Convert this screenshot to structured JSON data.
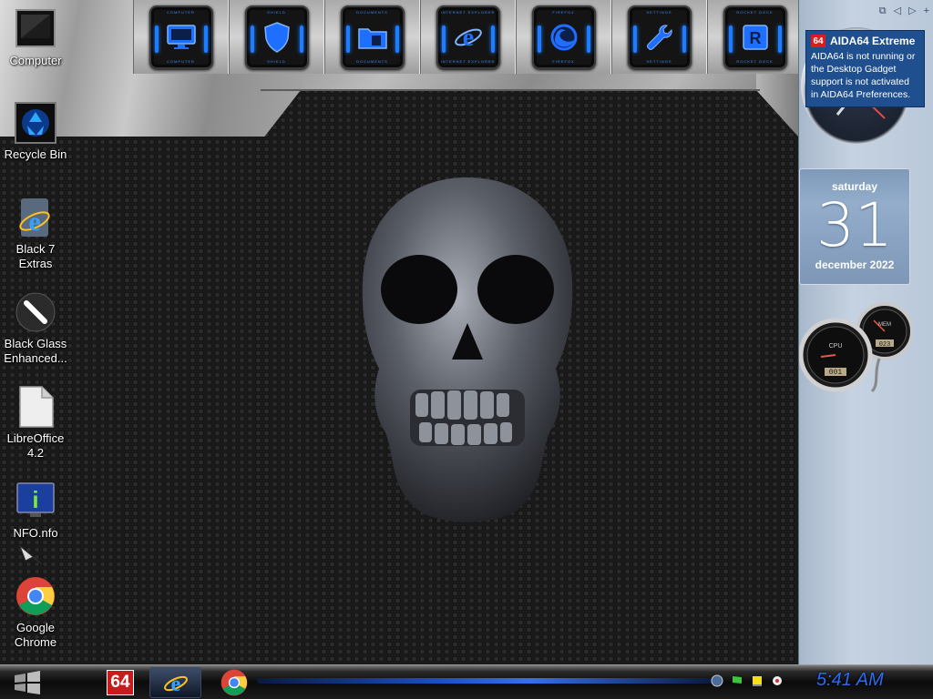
{
  "desktop_icons": [
    {
      "label": "Computer",
      "icon": "monitor-icon"
    },
    {
      "label": "Recycle Bin",
      "icon": "recycle-bin-icon"
    },
    {
      "label": "Black 7 Extras",
      "icon": "internet-explorer-icon"
    },
    {
      "label": "Black Glass Enhanced...",
      "icon": "pen-icon"
    },
    {
      "label": "LibreOffice 4.2",
      "icon": "document-icon"
    },
    {
      "label": "NFO.nfo",
      "icon": "info-icon"
    },
    {
      "label": "Google Chrome",
      "icon": "chrome-icon"
    }
  ],
  "dock": [
    {
      "label": "COMPUTER",
      "icon": "monitor-icon"
    },
    {
      "label": "SHIELD",
      "icon": "shield-icon"
    },
    {
      "label": "DOCUMENTS",
      "icon": "folder-icon"
    },
    {
      "label": "INTERNET EXPLORER",
      "icon": "internet-explorer-icon"
    },
    {
      "label": "FIREFOX",
      "icon": "firefox-icon"
    },
    {
      "label": "SETTINGS",
      "icon": "wrench-icon"
    },
    {
      "label": "ROCKET DOCK",
      "icon": "rocketdock-icon"
    }
  ],
  "sidebar": {
    "aida": {
      "logo": "64",
      "title": "AIDA64 Extreme",
      "message": "AIDA64 is not running or the Desktop Gadget support is not activated in AIDA64 Preferences."
    },
    "calendar": {
      "day": "saturday",
      "date": "31",
      "month": "december 2022"
    },
    "gauges": {
      "cpu_label": "CPU",
      "mem_label": "MEM",
      "cpu_readout": "001",
      "mem_readout": "023"
    }
  },
  "taskbar": {
    "aida_logo": "64",
    "clock": "5:41 AM",
    "colors": {
      "accent": "#2a6bf2"
    }
  }
}
